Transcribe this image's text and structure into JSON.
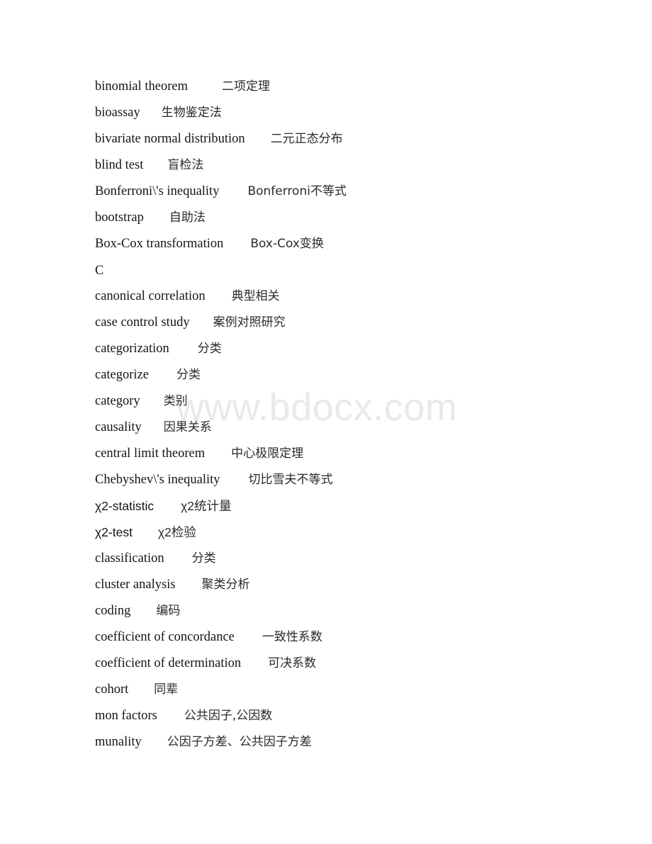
{
  "document": {
    "type": "glossary-page",
    "watermark": "www.bdocx.com",
    "watermark_color": "#e9e9e9",
    "background_color": "#ffffff",
    "text_color": "#1a1a1a"
  },
  "entries": [
    {
      "term": "binomial theorem",
      "gloss": "二项定理",
      "gap": 48,
      "style": "serif"
    },
    {
      "term": "bioassay",
      "gloss": "生物鉴定法",
      "gap": 30,
      "style": "serif"
    },
    {
      "term": "bivariate normal distribution",
      "gloss": "二元正态分布",
      "gap": 36,
      "style": "serif"
    },
    {
      "term": "blind test",
      "gloss": "盲检法",
      "gap": 34,
      "style": "serif"
    },
    {
      "term": "Bonferroni\\'s inequality",
      "gloss": "Bonferroni不等式",
      "gap": 40,
      "style": "serif"
    },
    {
      "term": "bootstrap",
      "gloss": "自助法",
      "gap": 36,
      "style": "serif"
    },
    {
      "term": "Box-Cox transformation",
      "gloss": "Box-Cox变换",
      "gap": 38,
      "style": "serif"
    },
    {
      "term": "C",
      "gloss": "",
      "gap": 0,
      "style": "heading"
    },
    {
      "term": "canonical correlation",
      "gloss": "典型相关",
      "gap": 37,
      "style": "serif"
    },
    {
      "term": "case control study",
      "gloss": "案例对照研究",
      "gap": 33,
      "style": "serif"
    },
    {
      "term": "categorization",
      "gloss": "分类",
      "gap": 40,
      "style": "serif"
    },
    {
      "term": "categorize",
      "gloss": "分类",
      "gap": 39,
      "style": "serif"
    },
    {
      "term": "category",
      "gloss": "类别",
      "gap": 33,
      "style": "serif"
    },
    {
      "term": "causality",
      "gloss": "因果关系",
      "gap": 31,
      "style": "serif"
    },
    {
      "term": "central limit theorem",
      "gloss": "中心极限定理",
      "gap": 37,
      "style": "serif"
    },
    {
      "term": "Chebyshev\\'s inequality",
      "gloss": "切比雪夫不等式",
      "gap": 40,
      "style": "serif"
    },
    {
      "term": "χ2-statistic",
      "gloss": "χ2统计量",
      "gap": 38,
      "style": "sans"
    },
    {
      "term": "χ2-test",
      "gloss": "χ2检验",
      "gap": 36,
      "style": "sans"
    },
    {
      "term": "classification",
      "gloss": "分类",
      "gap": 39,
      "style": "serif"
    },
    {
      "term": "cluster analysis",
      "gloss": "聚类分析",
      "gap": 37,
      "style": "serif"
    },
    {
      "term": "coding",
      "gloss": "编码",
      "gap": 36,
      "style": "serif"
    },
    {
      "term": "coefficient of concordance",
      "gloss": "一致性系数",
      "gap": 39,
      "style": "serif"
    },
    {
      "term": "coefficient of determination",
      "gloss": "可决系数",
      "gap": 38,
      "style": "serif"
    },
    {
      "term": "cohort",
      "gloss": "同辈",
      "gap": 36,
      "style": "serif"
    },
    {
      "term": "mon factors",
      "gloss": "公共因子,公因数",
      "gap": 38,
      "style": "serif"
    },
    {
      "term": "munality",
      "gloss": "公因子方差、公共因子方差",
      "gap": 36,
      "style": "serif"
    }
  ]
}
